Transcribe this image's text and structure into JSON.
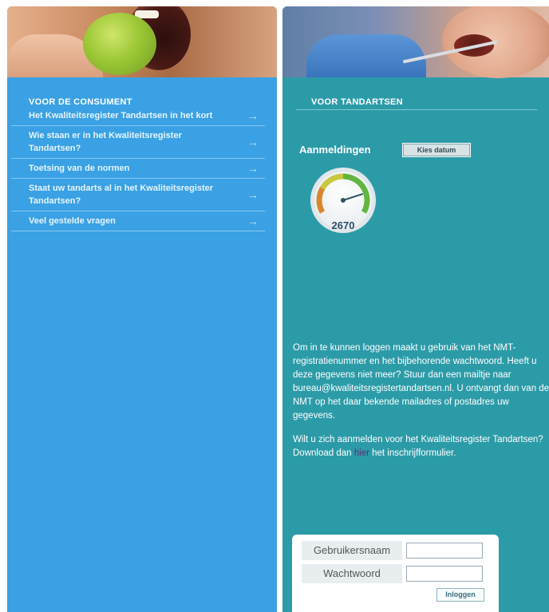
{
  "consumer": {
    "heading": "VOOR DE CONSUMENT",
    "items": [
      {
        "label": "Het Kwaliteitsregister Tandartsen in het kort"
      },
      {
        "label": "Wie staan er in het Kwaliteitsregister Tandartsen?"
      },
      {
        "label": "Toetsing van de normen"
      },
      {
        "label": "Staat uw tandarts al in het Kwaliteitsregister Tandartsen?"
      },
      {
        "label": "Veel gestelde vragen"
      }
    ],
    "arrow": "→"
  },
  "dentists": {
    "heading": "VOOR TANDARTSEN",
    "registrations_label": "Aanmeldingen",
    "choose_date_button": "Kies datum",
    "gauge_value": "2670",
    "gauge_level": 0.8,
    "info_paragraph_1": "Om in te kunnen loggen maakt u gebruik van het NMT-registratienummer en het bijbehorende wachtwoord. Heeft u deze gegevens niet meer? Stuur dan een mailtje naar bureau@kwaliteitsregistertandartsen.nl. U ontvangt dan van de NMT op het daar bekende mailadres of postadres uw gegevens.",
    "info_paragraph_2_before": "Wilt u zich aanmelden voor het Kwaliteitsregister Tandartsen? Download dan ",
    "info_link": "hier",
    "info_paragraph_2_after": " het inschrijfformulier."
  },
  "login": {
    "username_label": "Gebruikersnaam",
    "password_label": "Wachtwoord",
    "submit_label": "Inloggen",
    "username_value": "",
    "password_value": ""
  },
  "colors": {
    "consumer_panel": "#3aa1e4",
    "dentist_panel": "#2c9ba8",
    "link": "#5a2f7e"
  }
}
